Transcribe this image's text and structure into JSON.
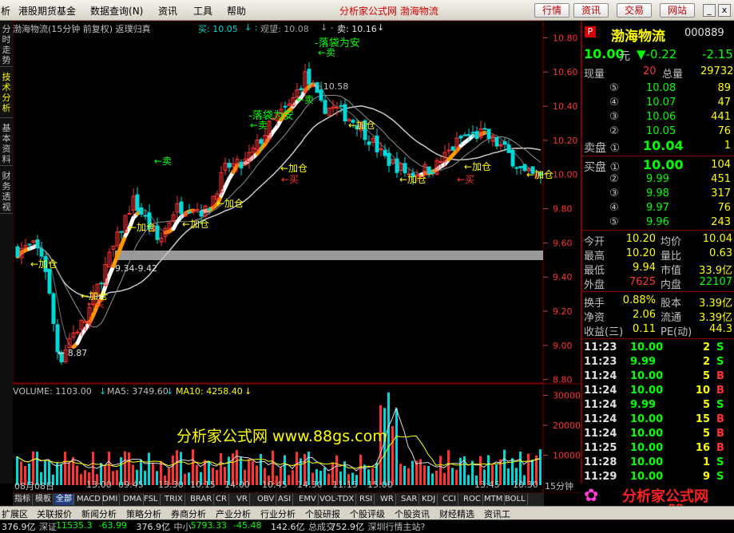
{
  "menu": {
    "item0": "析",
    "item1": "港股期货基金",
    "item2": "数据查询",
    "item2_hotkey": "(N)",
    "item3": "资讯",
    "item4": "工具",
    "item5": "帮助",
    "center": "分析家公式网  渤海物流",
    "btn_market": "行情",
    "btn_news": "资讯",
    "btn_trade": "交易",
    "btn_web": "网站",
    "minimize": "_",
    "close": "x"
  },
  "sidetabs": {
    "tab0": "分时走势",
    "tab1": "技术分析",
    "tab2": "基本资料",
    "tab3": "财务透视"
  },
  "chart": {
    "title": "渤海物流(15分钟 前复权) 返璞归真",
    "legend_buy": "买: 10.05",
    "legend_watch": "观望: 10.08",
    "legend_sell": "卖: 10.16",
    "ylim": [
      8.8,
      10.9
    ],
    "yticks": [
      "10.80",
      "10.60",
      "10.40",
      "10.20",
      "10.00",
      "9.80",
      "9.60",
      "9.40",
      "9.20",
      "9.00",
      "8.80"
    ],
    "annotations": {
      "top_caption": "-落袋为安",
      "hi": "10.58",
      "mid_caption": "-落袋为安",
      "lo": "8.87",
      "band_label": "9.34-9.42",
      "sell": "卖",
      "buy": "买",
      "add": "加仓"
    },
    "add_markers": [
      "←加仓",
      "←加仓",
      "←加仓",
      "←加仓",
      "←加仓",
      "←加仓",
      "←加仓",
      "←加仓",
      "←加仓",
      "←加仓",
      "←加仓",
      "←加仓"
    ],
    "sell_markers": [
      "←卖",
      "←卖",
      "←卖",
      "←卖"
    ],
    "buy_markers": [
      "←买",
      "←买",
      "←买",
      "←买"
    ],
    "watermark": "分析家公式网 www.88gs.com",
    "volume_label": "VOLUME: 1103.00",
    "ma5_label": "MA5: 3749.60",
    "ma10_label": "MA10: 4258.40",
    "vol_ticks": [
      "30000",
      "20000",
      "10000"
    ],
    "time_labels": [
      "08月08日",
      "13:00",
      "09:45",
      "13:30",
      "10:15",
      "14:00",
      "10:45",
      "14:30",
      "11:15",
      "15:00",
      "13:45",
      "10:30"
    ],
    "period": "15分钟"
  },
  "chart_data": {
    "type": "candlestick",
    "ylim": [
      8.8,
      10.9
    ],
    "price_high": 10.58,
    "price_low": 8.87,
    "support_band": [
      9.34,
      9.42
    ],
    "volume_ylim": [
      0,
      32000
    ],
    "volume_last": 1103.0,
    "ma5": 3749.6,
    "ma10": 4258.4
  },
  "indicator_tabs": [
    "指标",
    "模板",
    "全部",
    "MACD",
    "DMI",
    "DMA",
    "FSL",
    "TRIX",
    "BRAR",
    "CR",
    "VR",
    "OBV",
    "ASI",
    "EMV",
    "VOL-TDX",
    "RSI",
    "WR",
    "SAR",
    "KDJ",
    "CCI",
    "ROC",
    "MTM",
    "BOLL"
  ],
  "quote": {
    "symbol_flag": "P",
    "name": "渤海物流",
    "code": "000889",
    "price": "10.00",
    "unit": "元",
    "change": "▼-0.22",
    "change_pct": "-2.15",
    "now_vol_label": "现量",
    "now_vol": "20",
    "total_vol_label": "总量",
    "total_vol": "29732",
    "sells": [
      {
        "lvl": "⑤",
        "p": "10.08",
        "v": "89"
      },
      {
        "lvl": "④",
        "p": "10.07",
        "v": "47"
      },
      {
        "lvl": "③",
        "p": "10.06",
        "v": "441"
      },
      {
        "lvl": "②",
        "p": "10.05",
        "v": "76"
      },
      {
        "lvl": "卖盘 ①",
        "p": "10.04",
        "v": "1"
      }
    ],
    "buys": [
      {
        "lvl": "买盘 ①",
        "p": "10.00",
        "v": "104"
      },
      {
        "lvl": "②",
        "p": "9.99",
        "v": "451"
      },
      {
        "lvl": "③",
        "p": "9.98",
        "v": "317"
      },
      {
        "lvl": "④",
        "p": "9.97",
        "v": "76"
      },
      {
        "lvl": "⑤",
        "p": "9.96",
        "v": "243"
      }
    ],
    "stats": [
      {
        "a": "今开",
        "b": "10.20",
        "c": "均价",
        "d": "10.04"
      },
      {
        "a": "最高",
        "b": "10.20",
        "c": "量比",
        "d": "0.63"
      },
      {
        "a": "最低",
        "b": "9.94",
        "c": "市值",
        "d": "33.9亿"
      },
      {
        "a": "外盘",
        "b": "7625",
        "c": "内盘",
        "d": "22107"
      }
    ],
    "stats2": [
      {
        "a": "换手",
        "b": "0.88%",
        "c": "股本",
        "d": "3.39亿"
      },
      {
        "a": "净资",
        "b": "2.06",
        "c": "流通",
        "d": "3.39亿"
      },
      {
        "a": "收益(三)",
        "b": "0.11",
        "c": "PE(动)",
        "d": "44.3"
      }
    ],
    "ticks": [
      {
        "t": "11:23",
        "p": "10.00",
        "v": "2",
        "s": "S"
      },
      {
        "t": "11:23",
        "p": "9.99",
        "v": "2",
        "s": "S"
      },
      {
        "t": "11:24",
        "p": "10.00",
        "v": "5",
        "s": "B"
      },
      {
        "t": "11:24",
        "p": "10.00",
        "v": "10",
        "s": "B"
      },
      {
        "t": "11:24",
        "p": "9.99",
        "v": "5",
        "s": "S"
      },
      {
        "t": "11:24",
        "p": "10.00",
        "v": "15",
        "s": "B"
      },
      {
        "t": "11:24",
        "p": "10.00",
        "v": "5",
        "s": "B"
      },
      {
        "t": "11:25",
        "p": "10.00",
        "v": "16",
        "s": "B"
      },
      {
        "t": "11:28",
        "p": "10.00",
        "v": "1",
        "s": "S"
      },
      {
        "t": "11:29",
        "p": "10.00",
        "v": "9",
        "s": "S"
      }
    ],
    "logo": "分析家公式网",
    "logo_url": "www.88gs.com"
  },
  "bottom": {
    "items": [
      "扩展区",
      "关联报价",
      "新闻分析",
      "策略分析",
      "券商分析",
      "产业分析",
      "行业分析",
      "个股研报",
      "个股评级",
      "个股资讯",
      "财经精选",
      "资讯工"
    ],
    "ticker": [
      "376.9亿",
      "深证",
      "11535.3",
      "-63.99",
      "376.9亿",
      "中小",
      "5793.33",
      "-45.48",
      "142.6亿",
      "总成交",
      "752.9亿",
      "深圳行情主站?"
    ]
  },
  "colors": {
    "up": "#ff3232",
    "down": "#00d8d8",
    "ma_white": "#d0d0d0",
    "orange": "#ff9900",
    "green": "#00ff00",
    "yellow": "#ffff00",
    "frame": "#800000"
  }
}
